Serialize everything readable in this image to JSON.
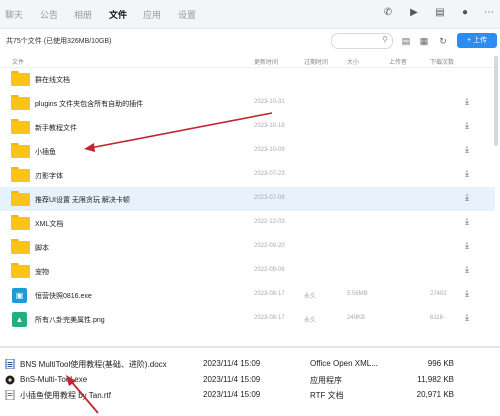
{
  "nav": {
    "tabs": [
      {
        "label": "聊天"
      },
      {
        "label": "公告"
      },
      {
        "label": "相册"
      },
      {
        "label": "文件"
      },
      {
        "label": "应用"
      },
      {
        "label": "设置"
      }
    ]
  },
  "toolbar": {
    "file_count": "共75个文件 (已使用326MB/10GB)",
    "upload_label": "+ 上传"
  },
  "columns": {
    "name": "文件",
    "updated": "更新时间",
    "expire": "过期时间",
    "size": "大小",
    "uploader": "上传者",
    "downloads": "下载次数"
  },
  "files": [
    {
      "name": "群在线文档",
      "date": "",
      "expire": "",
      "size": "",
      "uploader": "",
      "downloads": "",
      "kind": "folder"
    },
    {
      "name": "plugins 文件夹包含所有自助的插件",
      "date": "2023-10-31",
      "expire": "",
      "size": "",
      "uploader": "",
      "downloads": "",
      "kind": "folder"
    },
    {
      "name": "新手教程文件",
      "date": "2023-10-18",
      "expire": "",
      "size": "",
      "uploader": "",
      "downloads": "",
      "kind": "folder"
    },
    {
      "name": "小插鱼",
      "date": "2023-10-09",
      "expire": "",
      "size": "",
      "uploader": "",
      "downloads": "",
      "kind": "folder"
    },
    {
      "name": "刃影字体",
      "date": "2023-07-23",
      "expire": "",
      "size": "",
      "uploader": "",
      "downloads": "",
      "kind": "folder"
    },
    {
      "name": "推荐UI设置 无限贪玩 解决卡顿",
      "date": "2023-07-08",
      "expire": "",
      "size": "",
      "uploader": "",
      "downloads": "",
      "kind": "folder"
    },
    {
      "name": "XML文档",
      "date": "2022-12-03",
      "expire": "",
      "size": "",
      "uploader": "",
      "downloads": "",
      "kind": "folder"
    },
    {
      "name": "脚本",
      "date": "2022-09-20",
      "expire": "",
      "size": "",
      "uploader": "",
      "downloads": "",
      "kind": "folder"
    },
    {
      "name": "宠物",
      "date": "2022-09-06",
      "expire": "",
      "size": "",
      "uploader": "",
      "downloads": "",
      "kind": "folder"
    },
    {
      "name": "恒营快照0816.exe",
      "date": "2023-08-17",
      "expire": "永久",
      "size": "5.56MB",
      "uploader": "",
      "downloads": "27402",
      "kind": "exe"
    },
    {
      "name": "所有八卦完美属性.png",
      "date": "2023-08-17",
      "expire": "永久",
      "size": "249KB",
      "uploader": "",
      "downloads": "6116",
      "kind": "png"
    }
  ],
  "explorer": {
    "rows": [
      {
        "name": "BNS MultiTool使用教程(基础、进阶).docx",
        "date": "2023/11/4 15:09",
        "type": "Office Open XML...",
        "size": "996 KB",
        "icon": "doc-icon"
      },
      {
        "name": "BnS-Multi-Tool.exe",
        "date": "2023/11/4 15:09",
        "type": "应用程序",
        "size": "11,982 KB",
        "icon": "exe-icon"
      },
      {
        "name": "小插鱼使用教程 by Tan.rtf",
        "date": "2023/11/4 15:09",
        "type": "RTF 文档",
        "size": "20,971 KB",
        "icon": "rtf-icon"
      }
    ]
  },
  "colors": {
    "accent": "#2d8cf0",
    "folder": "#fcc419",
    "selected_row": "#e8f2fd",
    "annotation_arrow": "#c0262d"
  }
}
